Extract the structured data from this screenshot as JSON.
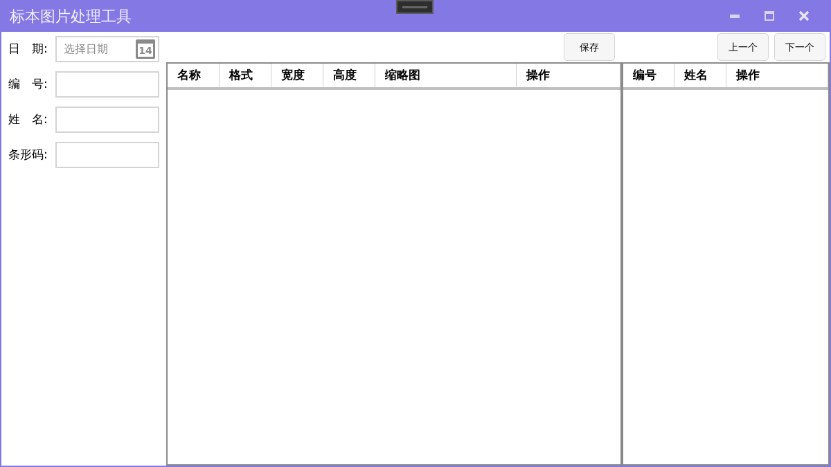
{
  "window": {
    "title": "标本图片处理工具"
  },
  "form": [
    {
      "label": "日　期:",
      "kind": "date",
      "placeholder": "选择日期"
    },
    {
      "label": "编　号:",
      "kind": "text"
    },
    {
      "label": "姓　名:",
      "kind": "text"
    },
    {
      "label": "条形码:",
      "kind": "text"
    }
  ],
  "calendar_day": "14",
  "toolbar": {
    "save": "保存",
    "prev": "上一个",
    "next": "下一个"
  },
  "image_table": {
    "columns": [
      "名称",
      "格式",
      "宽度",
      "高度",
      "缩略图",
      "操作"
    ]
  },
  "person_table": {
    "columns": [
      "编号",
      "姓名",
      "操作"
    ]
  }
}
